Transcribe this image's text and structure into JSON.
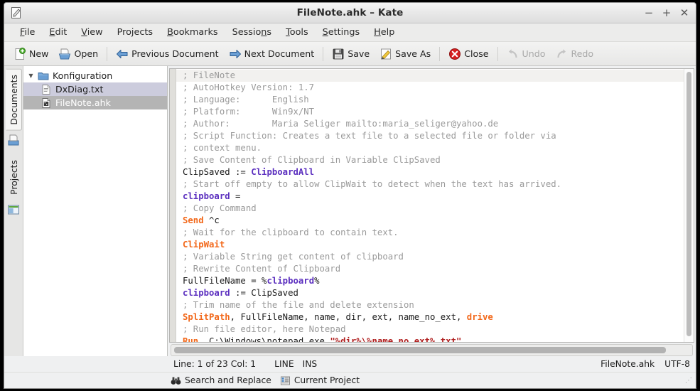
{
  "window": {
    "title": "FileNote.ahk – Kate",
    "app_icon": "kate-editor-icon",
    "controls": {
      "minimize": "−",
      "maximize": "+",
      "close": "✕"
    }
  },
  "menubar": {
    "items": [
      {
        "label": "File",
        "accel": "F"
      },
      {
        "label": "Edit",
        "accel": "E"
      },
      {
        "label": "View",
        "accel": "V"
      },
      {
        "label": "Projects",
        "accel": "j"
      },
      {
        "label": "Bookmarks",
        "accel": "B"
      },
      {
        "label": "Sessions",
        "accel": "n"
      },
      {
        "label": "Tools",
        "accel": "T"
      },
      {
        "label": "Settings",
        "accel": "S"
      },
      {
        "label": "Help",
        "accel": "H"
      }
    ]
  },
  "toolbar": {
    "new_label": "New",
    "open_label": "Open",
    "previous_document_label": "Previous Document",
    "next_document_label": "Next Document",
    "save_label": "Save",
    "save_as_label": "Save As",
    "close_label": "Close",
    "undo_label": "Undo",
    "redo_label": "Redo"
  },
  "sidebar": {
    "tabs": [
      {
        "label": "Documents",
        "icon": "documents-icon",
        "active": true
      },
      {
        "label": "Projects",
        "icon": "projects-icon",
        "active": false
      }
    ],
    "tree": {
      "root": {
        "label": "Konfiguration",
        "icon": "folder-icon",
        "expanded": true
      },
      "children": [
        {
          "label": "DxDiag.txt",
          "icon": "text-file-icon",
          "selected": "soft"
        },
        {
          "label": "FileNote.ahk",
          "icon": "script-file-icon",
          "selected": "hard"
        }
      ]
    }
  },
  "editor": {
    "lines": [
      {
        "current": true,
        "tokens": [
          {
            "t": "; FileNote",
            "c": "cm"
          }
        ]
      },
      {
        "current": false,
        "tokens": [
          {
            "t": "; AutoHotkey Version: 1.7",
            "c": "cm"
          }
        ]
      },
      {
        "current": false,
        "tokens": [
          {
            "t": "; Language:      English",
            "c": "cm"
          }
        ]
      },
      {
        "current": false,
        "tokens": [
          {
            "t": "; Platform:      Win9x/NT",
            "c": "cm"
          }
        ]
      },
      {
        "current": false,
        "tokens": [
          {
            "t": "; Author:        Maria Seliger mailto:maria_seliger@yahoo.de",
            "c": "cm"
          }
        ]
      },
      {
        "current": false,
        "tokens": [
          {
            "t": "; Script Function: Creates a text file to a selected file or folder via",
            "c": "cm"
          }
        ]
      },
      {
        "current": false,
        "tokens": [
          {
            "t": "; context menu.",
            "c": "cm"
          }
        ]
      },
      {
        "current": false,
        "tokens": [
          {
            "t": "; Save Content of Clipboard in Variable ClipSaved",
            "c": "cm"
          }
        ]
      },
      {
        "current": false,
        "tokens": [
          {
            "t": "ClipSaved := ",
            "c": "nm"
          },
          {
            "t": "ClipboardAll",
            "c": "va"
          }
        ]
      },
      {
        "current": false,
        "tokens": [
          {
            "t": "; Start off empty to allow ClipWait to detect when the text has arrived.",
            "c": "cm"
          }
        ]
      },
      {
        "current": false,
        "tokens": [
          {
            "t": "clipboard",
            "c": "va"
          },
          {
            "t": " =",
            "c": "nm"
          }
        ]
      },
      {
        "current": false,
        "tokens": [
          {
            "t": "; Copy Command",
            "c": "cm"
          }
        ]
      },
      {
        "current": false,
        "tokens": [
          {
            "t": "Send",
            "c": "kw"
          },
          {
            "t": " ^c",
            "c": "nm"
          }
        ]
      },
      {
        "current": false,
        "tokens": [
          {
            "t": "; Wait for the clipboard to contain text.",
            "c": "cm"
          }
        ]
      },
      {
        "current": false,
        "tokens": [
          {
            "t": "ClipWait",
            "c": "kw"
          }
        ]
      },
      {
        "current": false,
        "tokens": [
          {
            "t": "; Variable String get content of clipboard",
            "c": "cm"
          }
        ]
      },
      {
        "current": false,
        "tokens": [
          {
            "t": "; Rewrite Content of Clipboard",
            "c": "cm"
          }
        ]
      },
      {
        "current": false,
        "tokens": [
          {
            "t": "FullFileName = %",
            "c": "nm"
          },
          {
            "t": "clipboard",
            "c": "va"
          },
          {
            "t": "%",
            "c": "nm"
          }
        ]
      },
      {
        "current": false,
        "tokens": [
          {
            "t": "clipboard",
            "c": "va"
          },
          {
            "t": " := ClipSaved",
            "c": "nm"
          }
        ]
      },
      {
        "current": false,
        "tokens": [
          {
            "t": "; Trim name of the file and delete extension",
            "c": "cm"
          }
        ]
      },
      {
        "current": false,
        "tokens": [
          {
            "t": "SplitPath",
            "c": "kw"
          },
          {
            "t": ", FullFileName, name, dir, ext, name_no_ext, ",
            "c": "nm"
          },
          {
            "t": "drive",
            "c": "kw"
          }
        ]
      },
      {
        "current": false,
        "tokens": [
          {
            "t": "; Run file editor, here Notepad",
            "c": "cm"
          }
        ]
      },
      {
        "current": false,
        "tokens": [
          {
            "t": "Run",
            "c": "kw"
          },
          {
            "t": ", C:\\Windows\\notepad.exe ",
            "c": "nm"
          },
          {
            "t": "\"%dir%\\%name_no_ext%.txt\"",
            "c": "st"
          }
        ]
      }
    ]
  },
  "statusbar": {
    "line_col": "Line: 1 of 23 Col: 1",
    "line_mode": "LINE",
    "insert_mode": "INS",
    "filename": "FileNote.ahk",
    "encoding": "UTF-8",
    "search_replace_label": "Search and Replace",
    "search_replace_icon": "binoculars-icon",
    "current_project_label": "Current Project",
    "current_project_icon": "project-list-icon"
  },
  "colors": {
    "comment": "#9a9a9a",
    "keyword": "#f2681a",
    "variable": "#5b2fbf",
    "string": "#b02020",
    "selection_hard": "#b4b4b4",
    "selection_soft": "#ccccdd"
  }
}
